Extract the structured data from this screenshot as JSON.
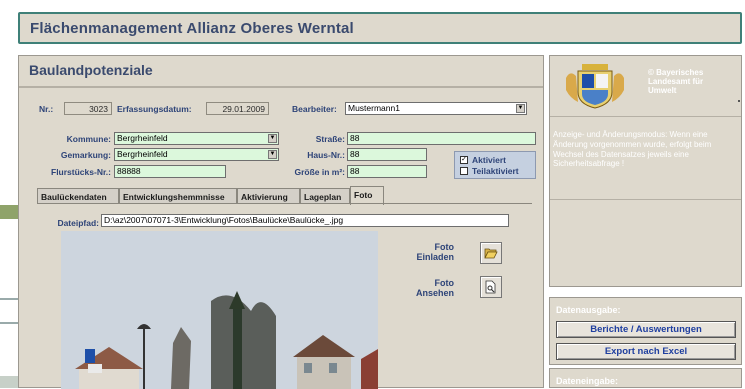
{
  "app": {
    "title": "Flächenmanagement Allianz Oberes Werntal"
  },
  "section": {
    "title": "Baulandpotenziale"
  },
  "record": {
    "nr_label": "Nr.:",
    "nr_value": "3023",
    "erfassung_label": "Erfassungsdatum:",
    "erfassung_value": "29.01.2009",
    "bearbeiter_label": "Bearbeiter:",
    "bearbeiter_value": "Mustermann1"
  },
  "fields": {
    "kommune_label": "Kommune:",
    "kommune_value": "Bergrheinfeld",
    "gemarkung_label": "Gemarkung:",
    "gemarkung_value": "Bergrheinfeld",
    "flurstueck_label": "Flurstücks-Nr.:",
    "flurstueck_value": "88888",
    "strasse_label": "Straße:",
    "strasse_value": "88",
    "hausnr_label": "Haus-Nr.:",
    "hausnr_value": "88",
    "groesse_label": "Größe in m²:",
    "groesse_value": "88"
  },
  "status": {
    "aktiviert_label": "Aktiviert",
    "aktiviert_checked": true,
    "teilaktiviert_label": "Teilaktiviert",
    "teilaktiviert_checked": false
  },
  "tabs": [
    {
      "label": "Baulückendaten",
      "active": false
    },
    {
      "label": "Entwicklungshemmnisse",
      "active": false
    },
    {
      "label": "Aktivierung",
      "active": false
    },
    {
      "label": "Lageplan",
      "active": false
    },
    {
      "label": "Foto",
      "active": true
    }
  ],
  "foto": {
    "dateipfad_label": "Dateipfad:",
    "dateipfad_value": "D:\\az\\2007\\07071-3\\Entwicklung\\Fotos\\Baulücke\\Baulücke_.jpg",
    "einladen_line1": "Foto",
    "einladen_line2": "Einladen",
    "ansehen_line1": "Foto",
    "ansehen_line2": "Ansehen"
  },
  "sidebar": {
    "logo_text_line1": "© Bayerisches",
    "logo_text_line2": "Landesamt für",
    "logo_text_line3": "Umwelt",
    "info_text": "Anzeige- und Änderungsmodus: Wenn eine Änderung vorgenommen wurde, erfolgt beim Wechsel des Datensatzes jeweils eine Sicherheitsabfrage !"
  },
  "datenausgabe": {
    "title": "Datenausgabe:",
    "berichte_label": "Berichte / Auswertungen",
    "export_label": "Export nach Excel"
  },
  "dateneingabe": {
    "title": "Dateneingabe:"
  },
  "colors": {
    "header_border": "#3f8078",
    "input_bg": "#dcf8dc",
    "panel_bg": "#ded9cd",
    "label_blue": "#2e4478"
  }
}
